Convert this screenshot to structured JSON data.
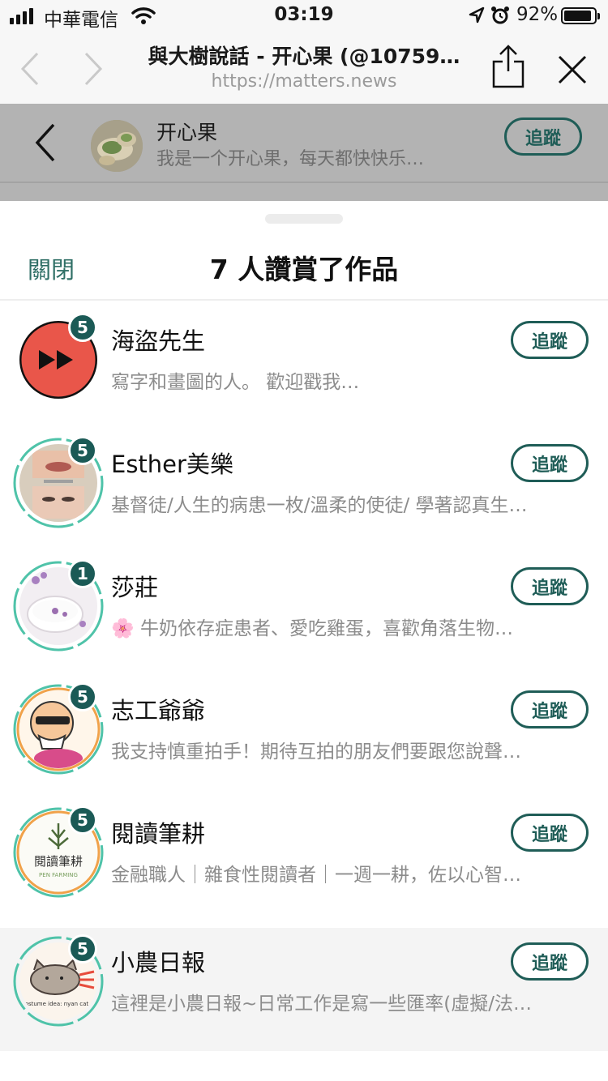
{
  "status_bar": {
    "carrier": "中華電信",
    "time": "03:19",
    "battery": "92%",
    "battery_level": 0.92
  },
  "browser": {
    "title": "與大樹說話 - 开心果 (@10759…",
    "url": "https://matters.news"
  },
  "page_header": {
    "name": "开心果",
    "description": "我是一个开心果，每天都快快乐…",
    "follow_label": "追蹤"
  },
  "sheet": {
    "close_label": "關閉",
    "title": "7 人讚賞了作品"
  },
  "users": [
    {
      "name": "海盜先生",
      "bio": "寫字和畫圖的人。 歡迎戳我…",
      "badge": "5",
      "follow_label": "追蹤",
      "avatar": "red-play-avatar",
      "ring": "none"
    },
    {
      "name": "Esther美樂",
      "bio": "基督徒/人生的病患一枚/溫柔的使徒/ 學著認真生…",
      "badge": "5",
      "follow_label": "追蹤",
      "avatar": "photo-face-avatar",
      "ring": "teal"
    },
    {
      "name": "莎莊",
      "bio": "🌸 牛奶依存症患者、愛吃雞蛋，喜歡角落生物…",
      "badge": "1",
      "follow_label": "追蹤",
      "avatar": "milk-flower-avatar",
      "ring": "teal"
    },
    {
      "name": "志工爺爺",
      "bio": "我支持慎重拍手！期待互拍的朋友們要跟您說聲…",
      "badge": "5",
      "follow_label": "追蹤",
      "avatar": "cartoon-grandpa-avatar",
      "ring": "orange-teal"
    },
    {
      "name": "閱讀筆耕",
      "bio": "金融職人｜雜食性閱讀者｜一週一耕，佐以心智…",
      "badge": "5",
      "follow_label": "追蹤",
      "avatar": "pen-farming-logo",
      "ring": "orange-teal",
      "logo_text": "閱讀筆耕",
      "logo_sub": "PEN FARMING"
    },
    {
      "name": "小農日報",
      "bio": "這裡是小農日報~日常工作是寫一些匯率(虛擬/法…",
      "badge": "5",
      "follow_label": "追蹤",
      "avatar": "cat-avatar",
      "ring": "teal",
      "highlight": true,
      "logo_text": "costume idea: nyan cat"
    }
  ],
  "colors": {
    "accent": "#1f5d57",
    "badge": "#1b5a56",
    "ring_teal": "#4fc3a9",
    "ring_orange": "#f0a24a",
    "overlay": "#b3b3b3"
  }
}
